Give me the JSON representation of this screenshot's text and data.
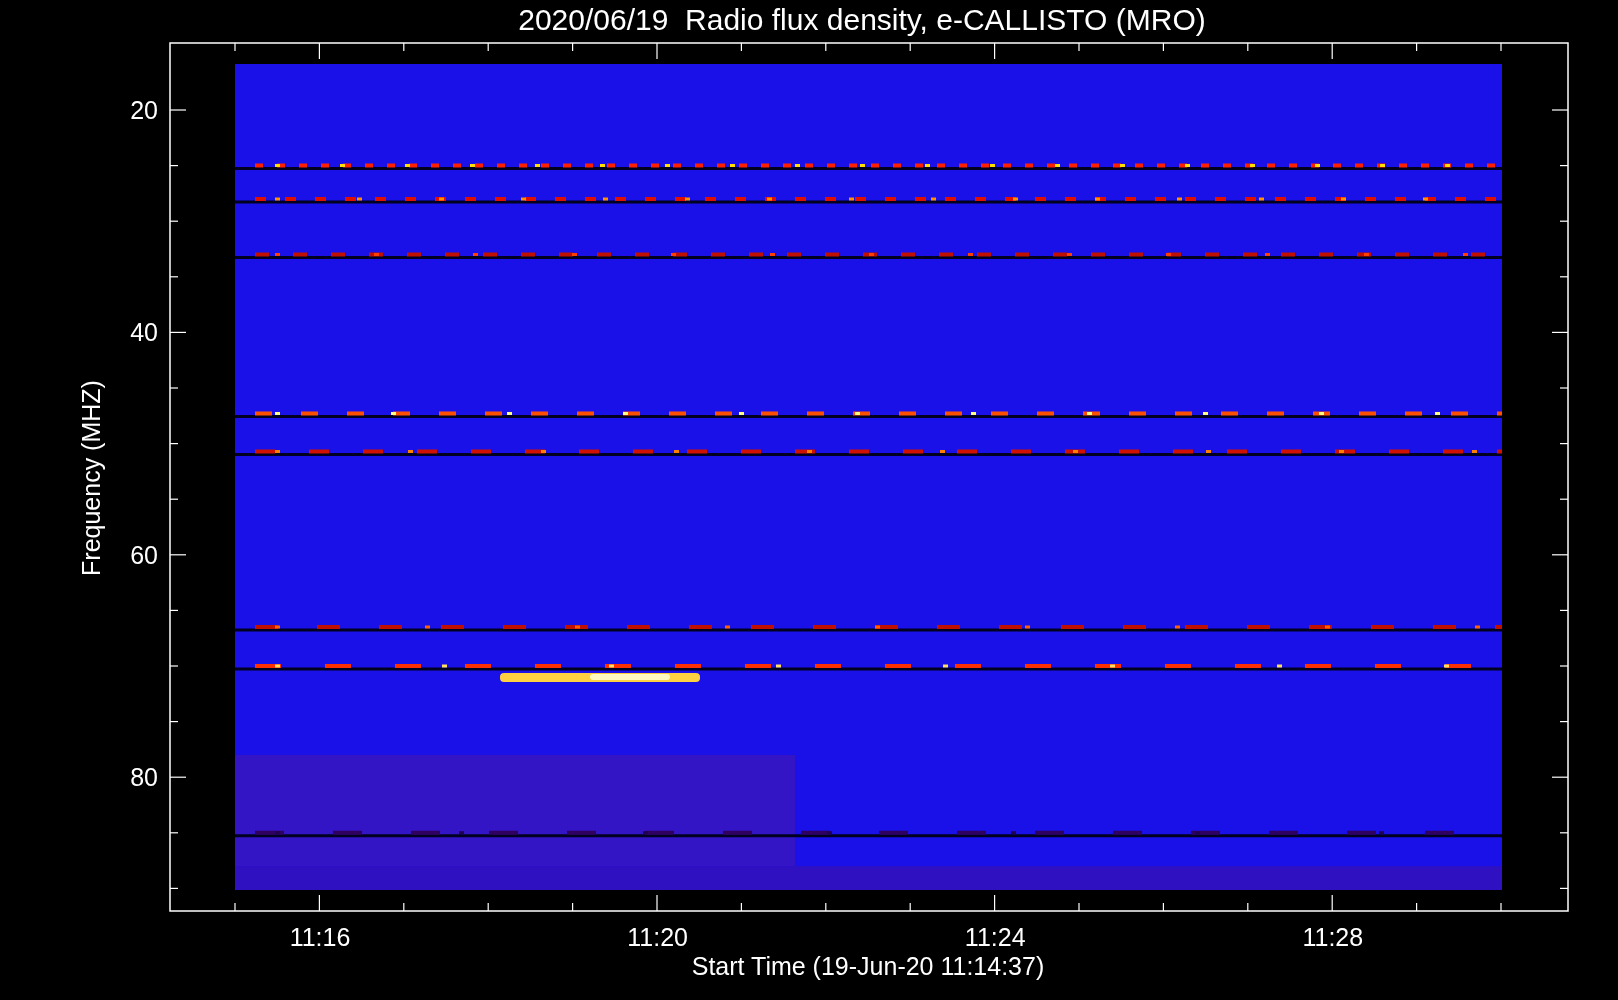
{
  "title": "2020/06/19  Radio flux density, e-CALLISTO (MRO)",
  "y_axis": {
    "label": "Frequency (MHZ)",
    "tick_labels": [
      "20",
      "40",
      "60",
      "80"
    ]
  },
  "x_axis": {
    "label": "Start Time (19-Jun-20 11:14:37)",
    "tick_labels": [
      "11:16",
      "11:20",
      "11:24",
      "11:28"
    ]
  }
}
